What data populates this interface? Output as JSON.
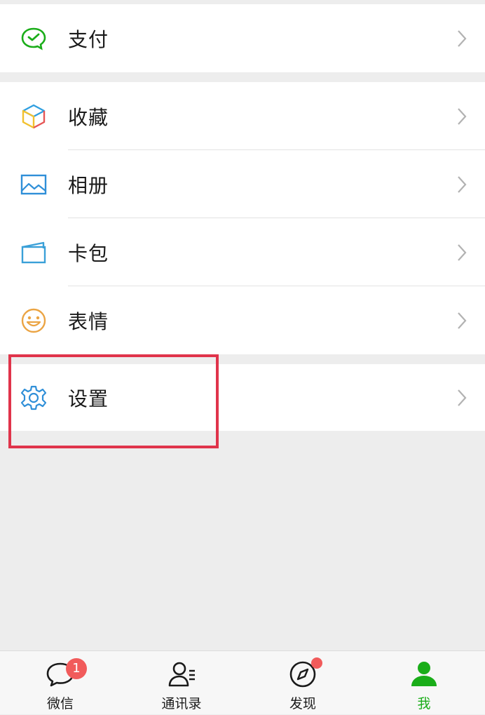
{
  "groups": [
    {
      "items": [
        {
          "label": "支付",
          "icon": "wechat-pay-icon"
        }
      ]
    },
    {
      "items": [
        {
          "label": "收藏",
          "icon": "favorites-cube-icon"
        },
        {
          "label": "相册",
          "icon": "album-icon"
        },
        {
          "label": "卡包",
          "icon": "card-wallet-icon"
        },
        {
          "label": "表情",
          "icon": "smiley-icon"
        }
      ]
    },
    {
      "items": [
        {
          "label": "设置",
          "icon": "gear-icon"
        }
      ]
    }
  ],
  "tabbar": {
    "tabs": [
      {
        "label": "微信",
        "icon": "chat-bubble-icon",
        "badge": "1"
      },
      {
        "label": "通讯录",
        "icon": "contacts-icon"
      },
      {
        "label": "发现",
        "icon": "compass-icon",
        "has_dot": true
      },
      {
        "label": "我",
        "icon": "person-icon",
        "active": true
      }
    ]
  },
  "colors": {
    "accent_green": "#1aad19",
    "badge_red": "#f15b5b",
    "highlight_border": "#e0344b",
    "background": "#ededed"
  }
}
